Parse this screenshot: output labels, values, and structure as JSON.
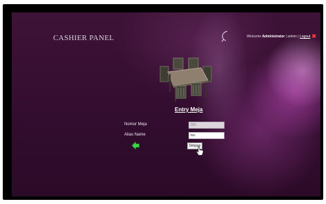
{
  "header": {
    "title": "CASHIER PANEL",
    "welcome_prefix": "Welcome",
    "user_name": "Administrator",
    "separator_left": " | ",
    "role": "admin",
    "separator_right": " | ",
    "logout_label": "Logout",
    "logout_icon": "close-x-icon"
  },
  "form": {
    "heading": "Entry Meja",
    "fields": [
      {
        "label": "Nomor Meja",
        "value": "001",
        "readonly": true
      },
      {
        "label": "Alias Name",
        "value": "tes",
        "readonly": false
      }
    ],
    "submit_label": "Simpan",
    "back_icon": "green-back-arrow-icon"
  },
  "illustration": "dining-table-icon",
  "colors": {
    "background": "#330d2f",
    "logout_x": "#ff3b3b",
    "back_arrow": "#3fd44a"
  }
}
